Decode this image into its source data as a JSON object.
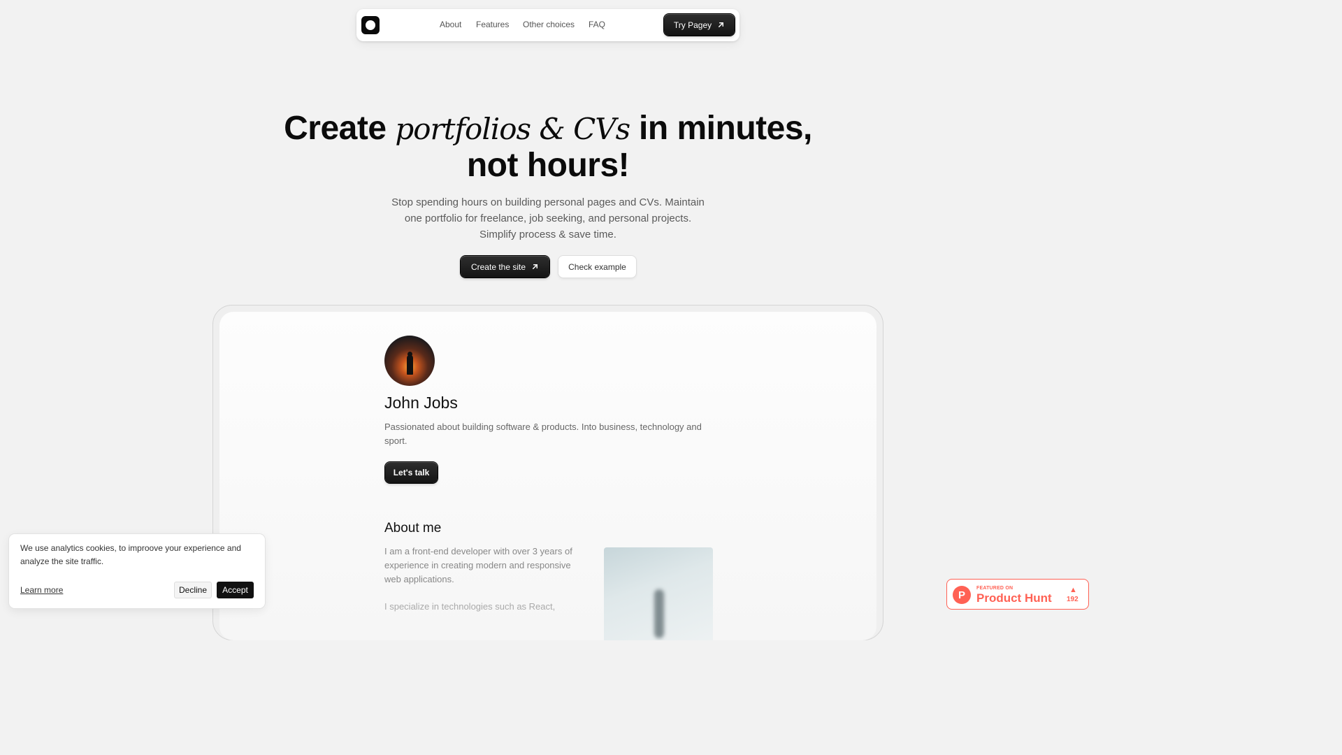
{
  "nav": {
    "links": [
      "About",
      "Features",
      "Other choices",
      "FAQ"
    ],
    "cta_label": "Try Pagey"
  },
  "hero": {
    "title_start": "Create ",
    "title_italic": "portfolios & CVs",
    "title_end": " in minutes,",
    "title_line2": "not hours!",
    "subtitle": "Stop spending hours on building personal pages and CVs. Maintain one portfolio for freelance, job seeking, and personal projects. Simplify process & save time.",
    "primary_button": "Create the site",
    "secondary_button": "Check example"
  },
  "preview": {
    "name": "John Jobs",
    "bio": "Passionated about building software & products. Into business, technology and sport.",
    "cta_label": "Let's talk",
    "about_title": "About me",
    "about_text": "I am a front-end developer with over 3 years of experience in creating modern and responsive web applications.",
    "about_text2": "I specialize in technologies such as React,"
  },
  "cookie": {
    "text": "We use analytics cookies, to improove your experience and analyze the site traffic.",
    "learn_more": "Learn more",
    "decline": "Decline",
    "accept": "Accept"
  },
  "product_hunt": {
    "featured": "FEATURED ON",
    "name": "Product Hunt",
    "votes": "192",
    "color": "#ff6154"
  }
}
